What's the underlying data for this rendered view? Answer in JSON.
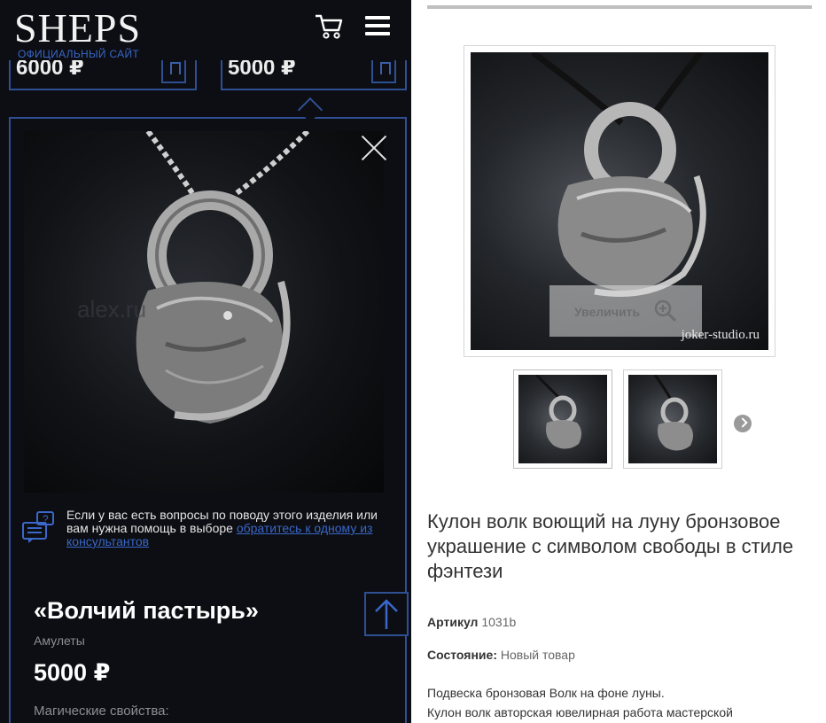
{
  "left": {
    "logo": "SHEPS",
    "logo_sub": "ОФИЦИАЛЬНЫЙ САЙТ",
    "prices": [
      "6000 ₽",
      "5000 ₽"
    ],
    "help_text": "Если у вас есть вопросы по поводу этого изделия или вам нужна помощь в выборе ",
    "help_link": "обратитесь к одному из консультантов",
    "watermark": "alex.ru",
    "product": {
      "title": "«Волчий пастырь»",
      "category": "Амулеты",
      "price": "5000 ₽",
      "magic": "Магические свойства:"
    }
  },
  "right": {
    "zoom_label": "Увеличить",
    "watermark": "joker-studio.ru",
    "title": "Кулон волк воющий на луну бронзовое украшение с символом свободы в стиле фэнтези",
    "article_label": "Артикул",
    "article_value": "1031b",
    "state_label": "Состояние:",
    "state_value": "Новый товар",
    "desc_1": "Подвеска бронзовая Волк на фоне луны.",
    "desc_2": "Кулон волк авторская ювелирная работа мастерской"
  },
  "icons": {
    "cart": "cart-icon",
    "menu": "hamburger-menu-icon",
    "close": "close-icon",
    "chat": "chat-question-icon",
    "arrow_up": "arrow-up-icon",
    "zoom": "zoom-in-icon",
    "next": "chevron-right-icon"
  },
  "colors": {
    "dark_bg": "#0c0e13",
    "accent_blue": "#2f4f93",
    "link_blue": "#3a67c9"
  }
}
